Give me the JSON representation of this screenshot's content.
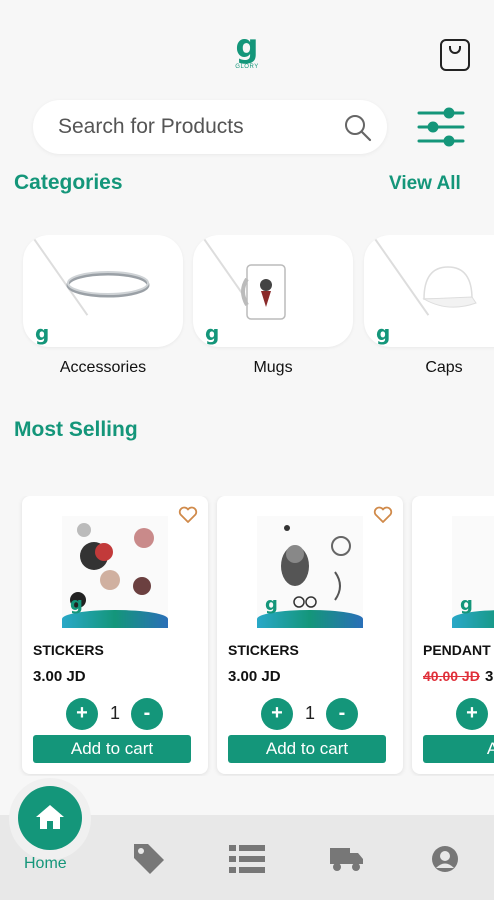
{
  "header": {
    "logo_letter": "g",
    "logo_text": "GLORY"
  },
  "search": {
    "placeholder": "Search for Products"
  },
  "categories": {
    "title": "Categories",
    "view_all": "View All",
    "items": [
      {
        "label": "Accessories"
      },
      {
        "label": "Mugs"
      },
      {
        "label": "Caps"
      }
    ]
  },
  "most_selling": {
    "title": "Most Selling",
    "products": [
      {
        "name": "STICKERS",
        "price": "3.00 JD",
        "qty": "1",
        "add_label": "Add to cart",
        "plus": "+",
        "minus": "-"
      },
      {
        "name": "STICKERS",
        "price": "3.00 JD",
        "qty": "1",
        "add_label": "Add to cart",
        "plus": "+",
        "minus": "-"
      },
      {
        "name": "PENDANT",
        "old_price": "40.00 JD",
        "price": "3",
        "add_label": "Add",
        "plus": "+"
      }
    ]
  },
  "nav": {
    "home_label": "Home"
  },
  "colors": {
    "accent": "#14967a",
    "sale": "#e0303a",
    "nav_bg": "#e8e8e8"
  }
}
